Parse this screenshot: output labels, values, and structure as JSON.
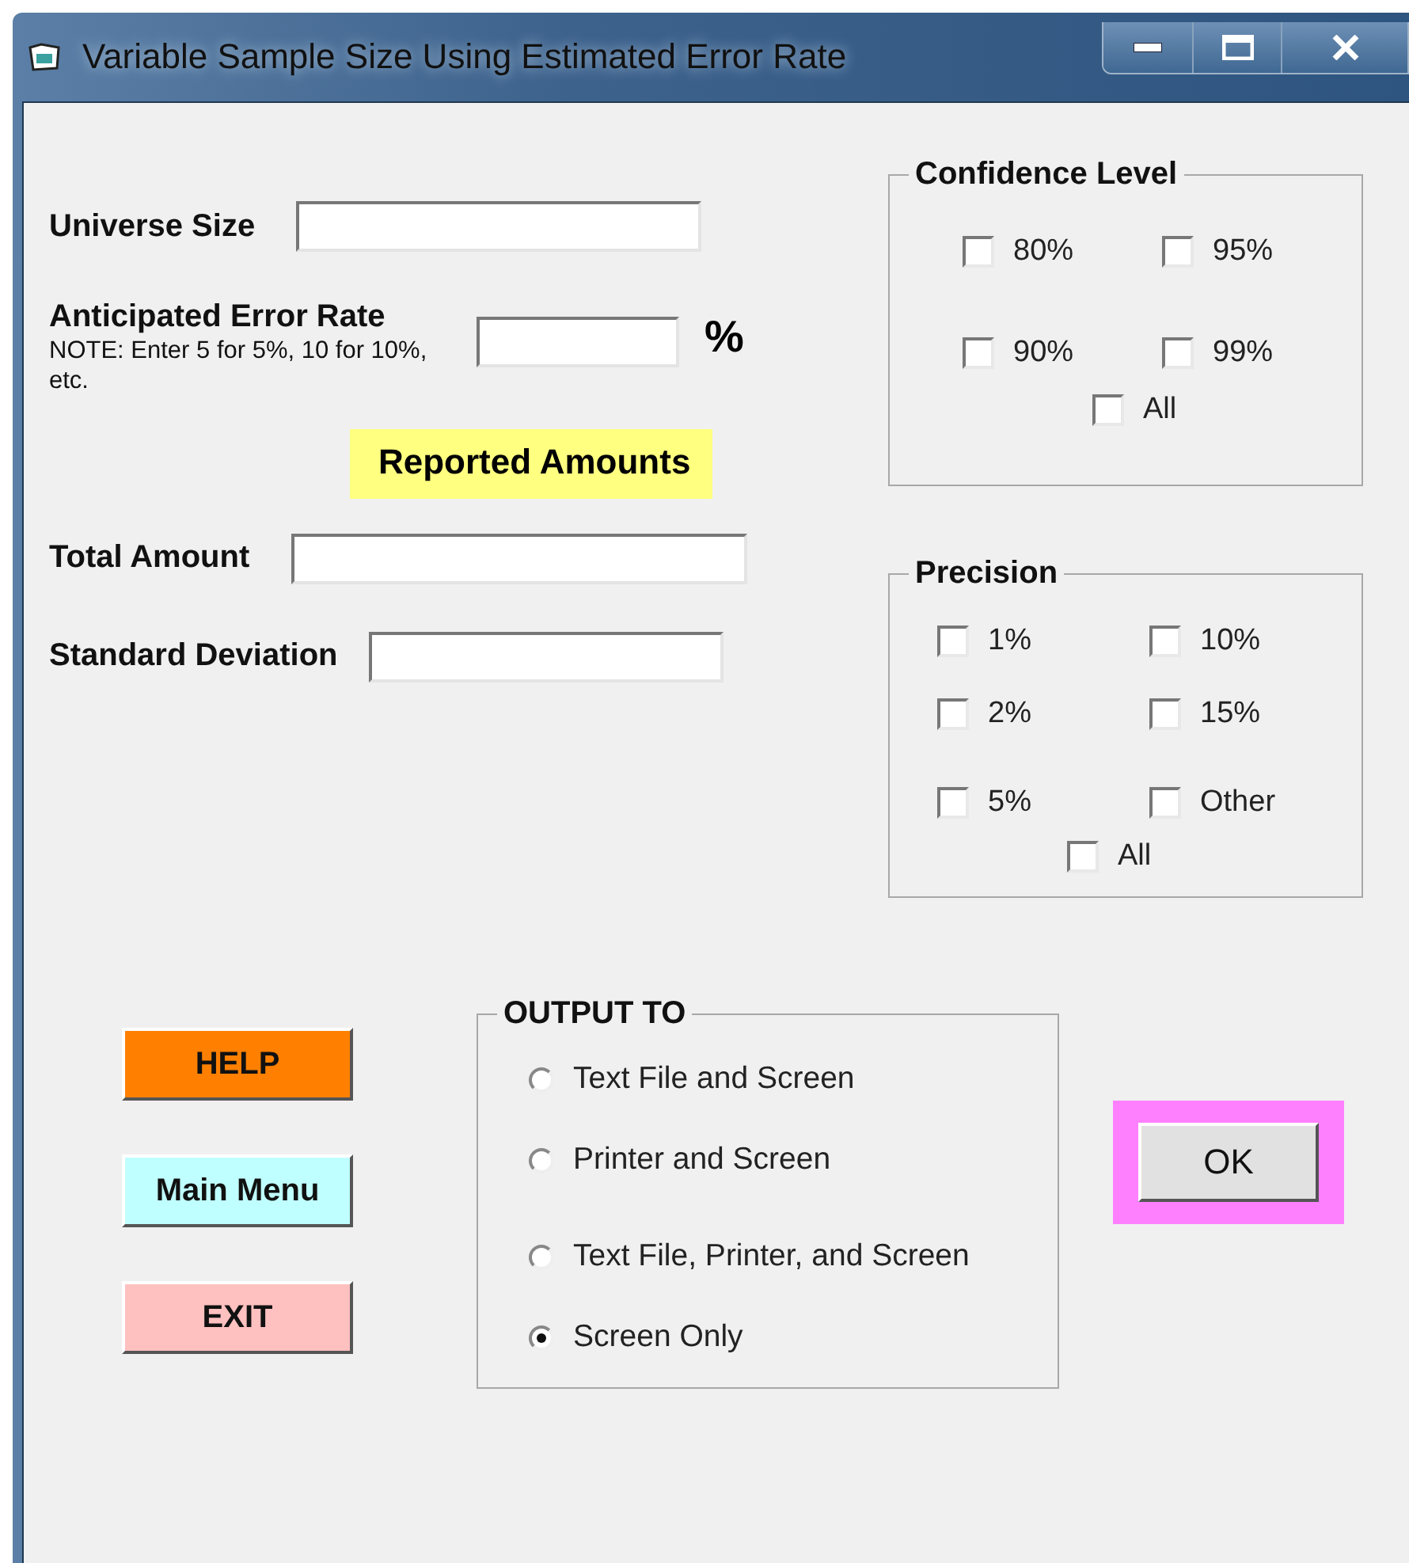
{
  "window": {
    "title": "Variable Sample Size Using Estimated Error Rate"
  },
  "universe_size": {
    "label": "Universe Size"
  },
  "error_rate": {
    "label": "Anticipated Error Rate",
    "note": "NOTE: Enter 5 for 5%, 10 for 10%, etc.",
    "unit": "%"
  },
  "reported_amounts": {
    "heading": "Reported Amounts",
    "fields": [
      {
        "label": "Total Amount"
      },
      {
        "label": "Standard Deviation"
      }
    ]
  },
  "confidence_level": {
    "title": "Confidence Level",
    "options": [
      {
        "label": "80%",
        "checked": false
      },
      {
        "label": "95%",
        "checked": false
      },
      {
        "label": "90%",
        "checked": false
      },
      {
        "label": "99%",
        "checked": false
      }
    ],
    "all": {
      "label": "All",
      "checked": false
    }
  },
  "precision": {
    "title": "Precision",
    "options": [
      {
        "label": "1%",
        "checked": false
      },
      {
        "label": "10%",
        "checked": false
      },
      {
        "label": "2%",
        "checked": false
      },
      {
        "label": "15%",
        "checked": false
      },
      {
        "label": "5%",
        "checked": false
      },
      {
        "label": "Other",
        "checked": false
      }
    ],
    "all": {
      "label": "All",
      "checked": false
    }
  },
  "buttons": [
    {
      "label": "HELP",
      "color": "#ff8000"
    },
    {
      "label": "Main Menu",
      "color": "#c0ffff"
    },
    {
      "label": "EXIT",
      "color": "#ffc0c0"
    }
  ],
  "output_to": {
    "title": "OUTPUT TO",
    "options": [
      {
        "label": "Text File and Screen",
        "selected": false
      },
      {
        "label": "Printer and Screen",
        "selected": false
      },
      {
        "label": "Text File, Printer, and Screen",
        "selected": false
      },
      {
        "label": "Screen Only",
        "selected": true
      }
    ]
  },
  "ok_button": {
    "label": "OK"
  }
}
